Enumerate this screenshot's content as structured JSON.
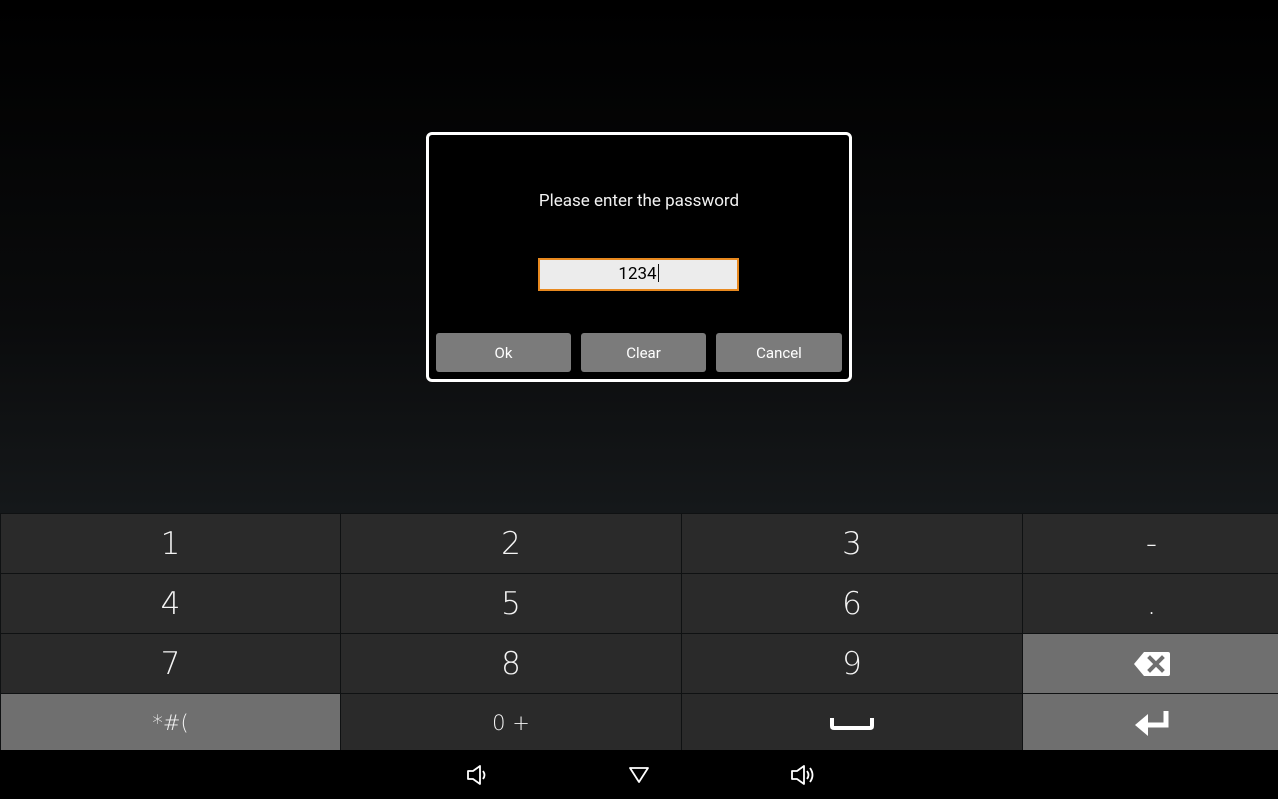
{
  "dialog": {
    "prompt": "Please enter the password",
    "password_value": "1234",
    "ok_label": "Ok",
    "clear_label": "Clear",
    "cancel_label": "Cancel"
  },
  "keyboard": {
    "row1": [
      "1",
      "2",
      "3",
      "-"
    ],
    "row2": [
      "4",
      "5",
      "6",
      "."
    ],
    "row3": [
      "7",
      "8",
      "9"
    ],
    "row4": [
      "*#(",
      "0 +"
    ],
    "icons": [
      "backspace-icon",
      "space-icon",
      "enter-icon"
    ]
  },
  "navbar": {
    "icons": [
      "volume-down-icon",
      "back-icon",
      "volume-up-icon"
    ]
  },
  "colors": {
    "accent_border": "#e8891f",
    "button_gray": "#7b7b7b",
    "key_dark": "#2a2a2a",
    "key_function": "#6f6f6f"
  }
}
